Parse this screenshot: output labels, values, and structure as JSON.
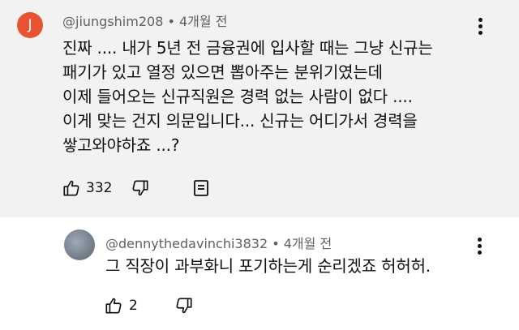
{
  "comment": {
    "avatar_letter": "J",
    "author": "@jiungshim208",
    "time": "4개월 전",
    "lines": [
      "진짜 .... 내가 5년 전 금융권에 입사할 때는 그냥 신규는",
      "패기가 있고 열정 있으면 뽑아주는 분위기였는데",
      "이제 들어오는 신규직원은 경력 없는 사람이 없다 ....",
      "이게 맞는 건지 의문입니다... 신규는 어디가서 경력을",
      "쌓고와야하죠 ...?"
    ],
    "like_count": "332"
  },
  "reply": {
    "author": "@dennythedavinchi3832",
    "time": "4개월 전",
    "text": "그 직장이 과부화니 포기하는게 순리겠죠 허허허.",
    "like_count": "2"
  },
  "separator": "•",
  "colors": {
    "avatar_bg": "#e8542f",
    "comment_bg": "#f2f2f2",
    "reply_bg": "#ffffff",
    "meta_text": "#606060"
  }
}
